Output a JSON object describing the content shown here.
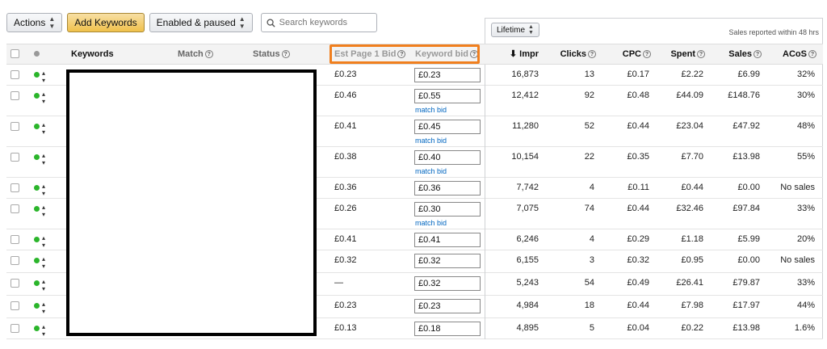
{
  "toolbar": {
    "actions_label": "Actions",
    "add_keywords_label": "Add Keywords",
    "filter_label": "Enabled & paused",
    "search_placeholder": "Search keywords"
  },
  "summary": {
    "lifetime_label": "Lifetime",
    "sales_note": "Sales reported within 48 hrs"
  },
  "columns": {
    "keywords": "Keywords",
    "match": "Match",
    "status": "Status",
    "est_page1_bid": "Est Page 1 Bid",
    "keyword_bid": "Keyword bid",
    "impr": "Impr",
    "clicks": "Clicks",
    "cpc": "CPC",
    "spent": "Spent",
    "sales": "Sales",
    "acos": "ACoS"
  },
  "match_bid_label": "match bid",
  "rows": [
    {
      "est": "£0.23",
      "bid": "£0.23",
      "match_bid": false,
      "impr": "16,873",
      "clicks": "13",
      "cpc": "£0.17",
      "spent": "£2.22",
      "sales": "£6.99",
      "acos": "32%"
    },
    {
      "est": "£0.46",
      "bid": "£0.55",
      "match_bid": true,
      "impr": "12,412",
      "clicks": "92",
      "cpc": "£0.48",
      "spent": "£44.09",
      "sales": "£148.76",
      "acos": "30%"
    },
    {
      "est": "£0.41",
      "bid": "£0.45",
      "match_bid": true,
      "impr": "11,280",
      "clicks": "52",
      "cpc": "£0.44",
      "spent": "£23.04",
      "sales": "£47.92",
      "acos": "48%"
    },
    {
      "est": "£0.38",
      "bid": "£0.40",
      "match_bid": true,
      "impr": "10,154",
      "clicks": "22",
      "cpc": "£0.35",
      "spent": "£7.70",
      "sales": "£13.98",
      "acos": "55%"
    },
    {
      "est": "£0.36",
      "bid": "£0.36",
      "match_bid": false,
      "impr": "7,742",
      "clicks": "4",
      "cpc": "£0.11",
      "spent": "£0.44",
      "sales": "£0.00",
      "acos": "No sales"
    },
    {
      "est": "£0.26",
      "bid": "£0.30",
      "match_bid": true,
      "impr": "7,075",
      "clicks": "74",
      "cpc": "£0.44",
      "spent": "£32.46",
      "sales": "£97.84",
      "acos": "33%"
    },
    {
      "est": "£0.41",
      "bid": "£0.41",
      "match_bid": false,
      "impr": "6,246",
      "clicks": "4",
      "cpc": "£0.29",
      "spent": "£1.18",
      "sales": "£5.99",
      "acos": "20%"
    },
    {
      "est": "£0.32",
      "bid": "£0.32",
      "match_bid": false,
      "impr": "6,155",
      "clicks": "3",
      "cpc": "£0.32",
      "spent": "£0.95",
      "sales": "£0.00",
      "acos": "No sales"
    },
    {
      "est": "—",
      "bid": "£0.32",
      "match_bid": false,
      "impr": "5,243",
      "clicks": "54",
      "cpc": "£0.49",
      "spent": "£26.41",
      "sales": "£79.87",
      "acos": "33%"
    },
    {
      "est": "£0.23",
      "bid": "£0.23",
      "match_bid": false,
      "impr": "4,984",
      "clicks": "18",
      "cpc": "£0.44",
      "spent": "£7.98",
      "sales": "£17.97",
      "acos": "44%"
    },
    {
      "est": "£0.13",
      "bid": "£0.18",
      "match_bid": false,
      "impr": "4,895",
      "clicks": "5",
      "cpc": "£0.04",
      "spent": "£0.22",
      "sales": "£13.98",
      "acos": "1.6%"
    }
  ],
  "colors": {
    "highlight": "#f07f1e",
    "status_enabled": "#2bb52b",
    "link": "#0066c0",
    "primary_button": "#f0c14b"
  }
}
